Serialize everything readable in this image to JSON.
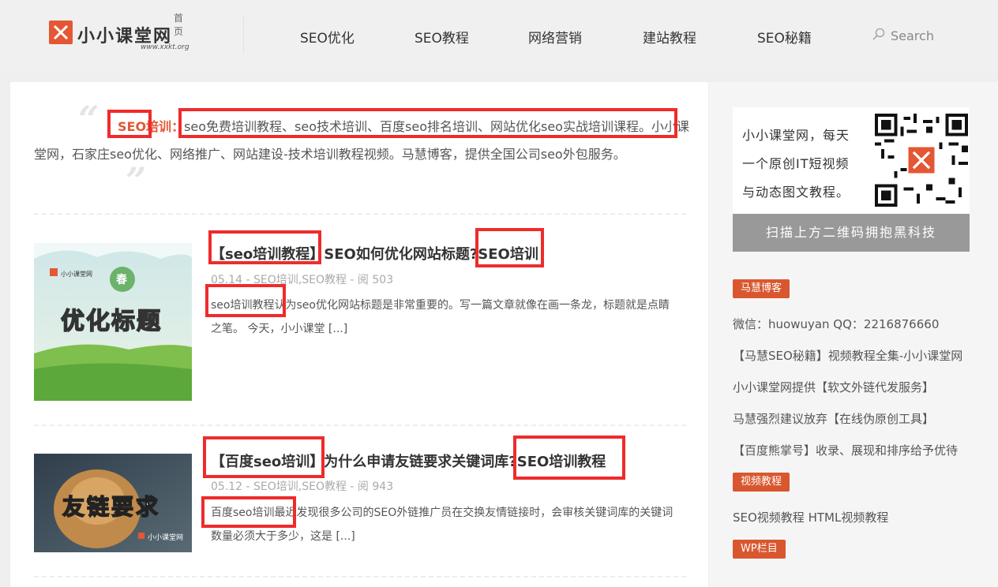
{
  "header": {
    "logo_text": "小小课堂网",
    "logo_home": "首页",
    "logo_url": "www.xxkt.org",
    "nav": [
      "SEO优化",
      "SEO教程",
      "网络营销",
      "建站教程",
      "SEO秘籍"
    ],
    "search_label": "Search"
  },
  "intro": {
    "highlight": "SEO培训",
    "sep": "：",
    "text": "seo免费培训教程、seo技术培训、百度seo排名培训、网站优化seo实战培训课程。小小课堂网，石家庄seo优化、网络推广、网站建设-技术培训教程视频。马慧博客，提供全国公司seo外包服务。"
  },
  "posts": [
    {
      "title": "【seo培训教程】SEO如何优化网站标题?SEO培训",
      "meta": "05.14 - SEO培训,SEO教程 - 阅 503",
      "excerpt": "seo培训教程认为seo优化网站标题是非常重要的。写一篇文章就像在画一条龙，标题就是点睛之笔。 今天，小小课堂",
      "more": "[...]",
      "thumb_text": "优化标题",
      "thumb_badge": "春",
      "thumb_logo": "小小课堂网"
    },
    {
      "title": "【百度seo培训】为什么申请友链要求关键词库?SEO培训教程",
      "meta": "05.12 - SEO培训,SEO教程 - 阅 943",
      "excerpt": "百度seo培训最近发现很多公司的SEO外链推广员在交换友情链接时，会审核关键词库的关键词数量必须大于多少，这是",
      "more": "[...]",
      "thumb_text": "友链要求",
      "thumb_logo": "小小课堂网"
    }
  ],
  "sidebar": {
    "qr_lines": [
      "小小课堂网，每天",
      "一个原创IT短视频",
      "与动态图文教程。"
    ],
    "scan_text": "扫描上方二维码拥抱黑科技",
    "badge1": "马慧博客",
    "contact": "微信：huowuyan    QQ：2216876660",
    "links": [
      "【马慧SEO秘籍】视频教程全集-小小课堂网",
      "小小课堂网提供【软文外链代发服务】",
      "马慧强烈建议放弃【在线伪原创工具】",
      "【百度熊掌号】收录、展现和排序给予优待"
    ],
    "badge2": "视频教程",
    "video_links": "SEO视频教程   HTML视频教程",
    "badge3": "WP栏目"
  },
  "colors": {
    "accent": "#e45735",
    "annotation_red": "#ef2b2b"
  },
  "icons": [
    "logo-x-icon",
    "search-icon",
    "quote-open-icon",
    "quote-close-icon",
    "qr-code-icon"
  ]
}
